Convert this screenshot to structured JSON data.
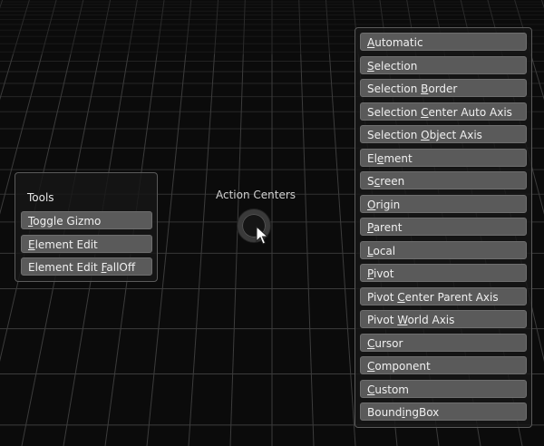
{
  "pie": {
    "title": "Action Centers"
  },
  "tools": {
    "title": "Tools",
    "items": [
      {
        "label": "Toggle Gizmo",
        "u": 0
      },
      {
        "label": "Element Edit",
        "u": 0
      },
      {
        "label": "Element Edit FallOff",
        "u": 13
      }
    ]
  },
  "action_centers": {
    "items": [
      {
        "label": "Automatic",
        "u": 0
      },
      {
        "label": "Selection",
        "u": 0
      },
      {
        "label": "Selection Border",
        "u": 10
      },
      {
        "label": "Selection Center Auto Axis",
        "u": 10
      },
      {
        "label": "Selection Object Axis",
        "u": 10
      },
      {
        "label": "Element",
        "u": 2
      },
      {
        "label": "Screen",
        "u": 1
      },
      {
        "label": "Origin",
        "u": 0
      },
      {
        "label": "Parent",
        "u": 0
      },
      {
        "label": "Local",
        "u": 0
      },
      {
        "label": "Pivot",
        "u": 0
      },
      {
        "label": "Pivot Center Parent Axis",
        "u": 6
      },
      {
        "label": "Pivot World Axis",
        "u": 6
      },
      {
        "label": "Cursor",
        "u": 0
      },
      {
        "label": "Component",
        "u": 0
      },
      {
        "label": "Custom",
        "u": 0
      },
      {
        "label": "BoundingBox",
        "u": 5
      }
    ]
  },
  "colors": {
    "background": "#0b0b0b",
    "grid": "#3c3c3c",
    "button": "#5a5a5a",
    "panel_border": "#5a5a5a"
  }
}
